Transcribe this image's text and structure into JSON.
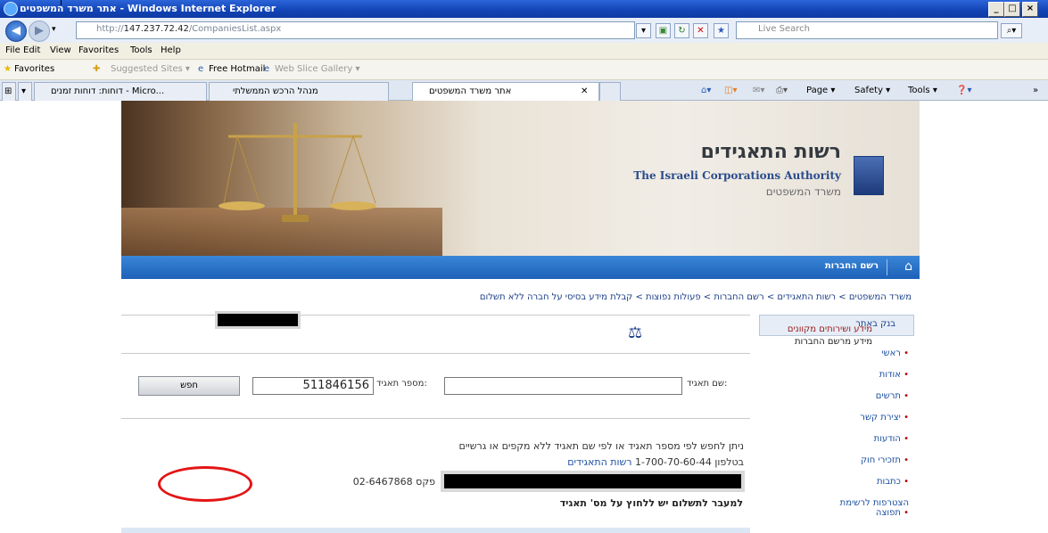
{
  "window": {
    "title": "אתר משרד המשפטים - Windows Internet Explorer"
  },
  "address": {
    "url_prefix": "http://",
    "url_host": "147.237.72.42",
    "url_path": "/CompaniesList.aspx",
    "search_placeholder": "Live Search"
  },
  "menu": [
    "File",
    "Edit",
    "View",
    "Favorites",
    "Tools",
    "Help"
  ],
  "favorites": {
    "label": "Favorites",
    "suggested": "Suggested Sites ▾",
    "hotmail": "Free Hotmail",
    "gallery": "Web Slice Gallery ▾"
  },
  "tabs": [
    {
      "label": "דוחות: דוחות זמנים - Micro..."
    },
    {
      "label": "מנהל הרכש הממשלתי"
    },
    {
      "label": "אתר משרד המשפטים"
    }
  ],
  "commands": {
    "page": "Page ▾",
    "safety": "Safety ▾",
    "tools": "Tools ▾"
  },
  "banner": {
    "title_he": "רשות התאגידים",
    "title_en": "The Israeli Corporations Authority",
    "ministry_he": "משרד המשפטים"
  },
  "bluebar": {
    "label": "רשם החברות"
  },
  "breadcrumb": "משרד המשפטים > רשות התאגידים > רשם החברות > פעולות נפוצות > קבלת מידע בסיסי על חברה ללא תשלום",
  "section": {
    "title": "מידע ושירותים מקוונים",
    "subtitle": "מידע מרשם החברות"
  },
  "form": {
    "name_label": "שם תאגיד:",
    "name_value": "",
    "number_label": "מספר תאגיד:",
    "number_value": "511846156",
    "search_button": "חפש"
  },
  "info": {
    "line1": "ניתן לחפש לפי מספר תאגיד או לפי שם תאגיד ללא מקפים או גרשיים",
    "line2_prefix": "בטלפון 1-700-70-60-44",
    "line2_link": "רשות התאגידים",
    "line3": "פקס 02-6467868",
    "line4": "למעבר לתשלום יש ללחוץ על מס' תאגיד"
  },
  "sidebar": {
    "header": "בנק באתר",
    "items": [
      "ראשי",
      "אודות",
      "תרשים",
      "יצירת קשר",
      "הודעות",
      "תזכירי חוק",
      "כתבות",
      "הצטרפות לרשימת תפוצה"
    ]
  }
}
